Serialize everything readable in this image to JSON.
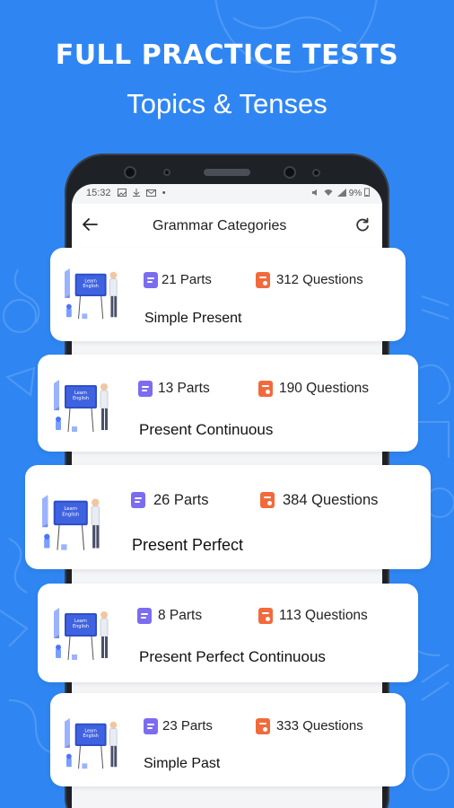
{
  "headline": "FULL PRACTICE TESTS",
  "subheadline": "Topics & Tenses",
  "status_bar": {
    "time": "15:32",
    "notification_icons": [
      "image-icon",
      "download-icon",
      "mail-icon"
    ],
    "right": "9%"
  },
  "app_bar": {
    "back_icon": "arrow-left-icon",
    "title": "Grammar Categories",
    "refresh_icon": "refresh-icon"
  },
  "categories": [
    {
      "title": "Simple Present",
      "parts": "21 Parts",
      "questions": "312 Questions",
      "parts_icon": "document-icon",
      "questions_icon": "quiz-icon"
    },
    {
      "title": "Present Continuous",
      "parts": "13 Parts",
      "questions": "190 Questions",
      "parts_icon": "document-icon",
      "questions_icon": "quiz-icon"
    },
    {
      "title": "Present Perfect",
      "parts": "26 Parts",
      "questions": "384 Questions",
      "parts_icon": "document-icon",
      "questions_icon": "quiz-icon"
    },
    {
      "title": "Present Perfect Continuous",
      "parts": "8 Parts",
      "questions": "113 Questions",
      "parts_icon": "document-icon",
      "questions_icon": "quiz-icon"
    },
    {
      "title": "Simple Past",
      "parts": "23 Parts",
      "questions": "333 Questions",
      "parts_icon": "document-icon",
      "questions_icon": "quiz-icon"
    }
  ],
  "colors": {
    "background": "#2f86f2",
    "parts_icon": "#7b6cf0",
    "questions_icon": "#f26a3c"
  }
}
